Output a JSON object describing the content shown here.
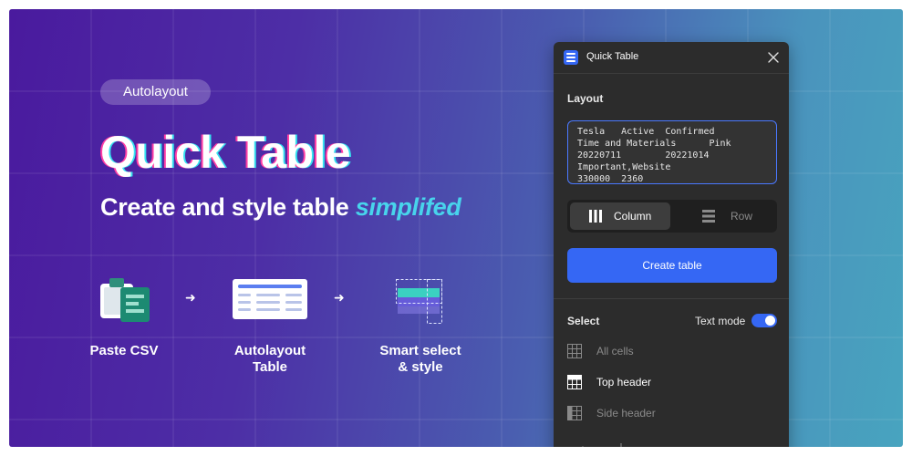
{
  "hero": {
    "badge": "Autolayout",
    "title": "Quick Table",
    "subtitle_main": "Create and style table",
    "subtitle_accent": "simplifed"
  },
  "features": [
    {
      "label_line1": "Paste CSV",
      "label_line2": "",
      "icon": "clipboard-csv-icon"
    },
    {
      "label_line1": "Autolayout",
      "label_line2": "Table",
      "icon": "table-layout-icon"
    },
    {
      "label_line1": "Smart select",
      "label_line2": "& style",
      "icon": "smart-select-icon"
    }
  ],
  "panel": {
    "title": "Quick Table",
    "layout_label": "Layout",
    "csv_lines": [
      "Tesla   Active  Confirmed",
      "Time and Materials      Pink",
      "20220711        20221014",
      "Important,Website",
      "330000  2360"
    ],
    "layout_options": {
      "column": "Column",
      "row": "Row",
      "selected": "Column"
    },
    "create_button": "Create table",
    "select_label": "Select",
    "text_mode_label": "Text mode",
    "text_mode_on": true,
    "select_items": [
      {
        "label": "All cells",
        "active": false
      },
      {
        "label": "Top header",
        "active": true
      },
      {
        "label": "Side header",
        "active": false
      }
    ]
  },
  "colors": {
    "accent": "#3567f4",
    "accent_cyan": "#48d4ec",
    "panel_bg": "#2c2c2c",
    "gradient_start": "#4a1a9e",
    "gradient_end": "#48a4bf"
  }
}
